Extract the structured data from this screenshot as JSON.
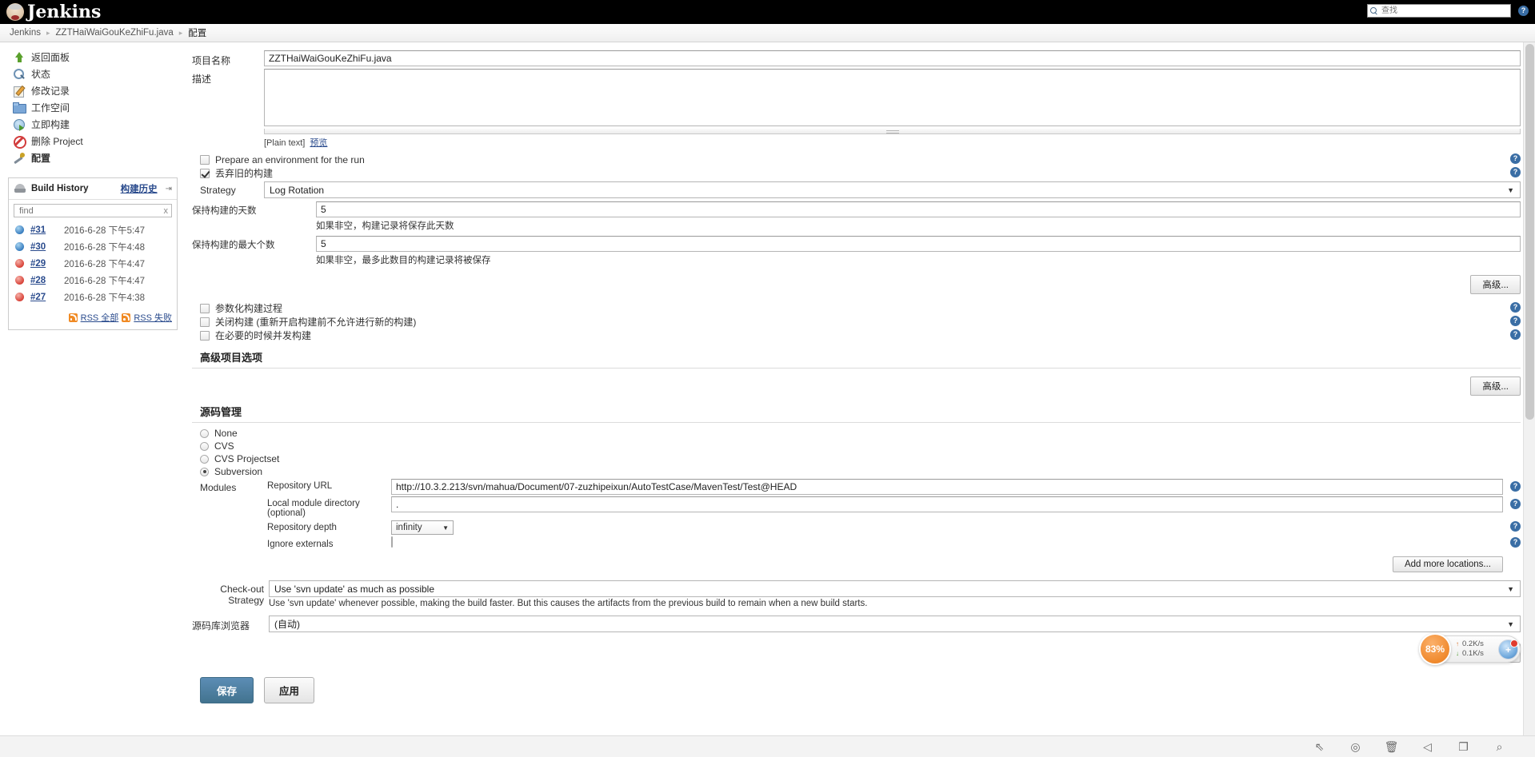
{
  "header": {
    "brand": "Jenkins",
    "search_placeholder": "查找",
    "help_label": "?"
  },
  "breadcrumb": {
    "root": "Jenkins",
    "project": "ZZTHaiWaiGouKeZhiFu.java",
    "current": "配置",
    "separator": "▸"
  },
  "sidebar": {
    "items": [
      {
        "label": "返回面板",
        "icon": "up-arrow-icon"
      },
      {
        "label": "状态",
        "icon": "search-icon"
      },
      {
        "label": "修改记录",
        "icon": "changes-icon"
      },
      {
        "label": "工作空间",
        "icon": "folder-icon"
      },
      {
        "label": "立即构建",
        "icon": "build-now-icon"
      },
      {
        "label": "删除 Project",
        "icon": "delete-icon"
      },
      {
        "label": "配置",
        "icon": "config-wrench-icon"
      }
    ],
    "build_history": {
      "title": "Build History",
      "link": "构建历史",
      "arrow": "⇥",
      "find_placeholder": "find",
      "clear": "x",
      "rows": [
        {
          "number": "#31",
          "date": "2016-6-28 下午5:47",
          "status": "blue"
        },
        {
          "number": "#30",
          "date": "2016-6-28 下午4:48",
          "status": "blue"
        },
        {
          "number": "#29",
          "date": "2016-6-28 下午4:47",
          "status": "red"
        },
        {
          "number": "#28",
          "date": "2016-6-28 下午4:47",
          "status": "red"
        },
        {
          "number": "#27",
          "date": "2016-6-28 下午4:38",
          "status": "red"
        }
      ],
      "rss_all": "RSS 全部",
      "rss_failed": "RSS 失败"
    }
  },
  "form": {
    "project_name_label": "项目名称",
    "project_name_value": "ZZTHaiWaiGouKeZhiFu.java",
    "description_label": "描述",
    "description_value": "",
    "plain_text": "[Plain text]",
    "preview_link": "预览",
    "prepare_env_label": "Prepare an environment for the run",
    "discard_builds_label": "丢弃旧的构建",
    "strategy_label": "Strategy",
    "strategy_value": "Log Rotation",
    "days_label": "保持构建的天数",
    "days_value": "5",
    "days_hint": "如果非空，构建记录将保存此天数",
    "max_label": "保持构建的最大个数",
    "max_value": "5",
    "max_hint": "如果非空，最多此数目的构建记录将被保存",
    "advanced_button": "高级...",
    "param_build_label": "参数化构建过程",
    "disable_build_label": "关闭构建 (重新开启构建前不允许进行新的构建)",
    "concurrent_build_label": "在必要的时候并发构建",
    "advanced_project_options": "高级项目选项"
  },
  "scm": {
    "title": "源码管理",
    "options": [
      {
        "label": "None",
        "selected": false
      },
      {
        "label": "CVS",
        "selected": false
      },
      {
        "label": "CVS Projectset",
        "selected": false
      },
      {
        "label": "Subversion",
        "selected": true
      }
    ],
    "modules_label": "Modules",
    "repo_url_label": "Repository URL",
    "repo_url_value": "http://10.3.2.213/svn/mahua/Document/07-zuzhipeixun/AutoTestCase/MavenTest/Test@HEAD",
    "local_dir_label": "Local module directory (optional)",
    "local_dir_value": ".",
    "depth_label": "Repository depth",
    "depth_value": "infinity",
    "ignore_externals_label": "Ignore externals",
    "add_locations_button": "Add more locations...",
    "checkout_strategy_label": "Check-out Strategy",
    "checkout_strategy_value": "Use 'svn update' as much as possible",
    "checkout_strategy_hint": "Use 'svn update' whenever possible, making the build faster. But this causes the artifacts from the previous build to remain when a new build starts.",
    "browser_label": "源码库浏览器",
    "browser_value": "(自动)",
    "advanced_button": "高级..."
  },
  "actions": {
    "save": "保存",
    "apply": "应用"
  },
  "net_widget": {
    "percent": "83%",
    "upload": "0.2K/s",
    "download": "0.1K/s",
    "up_arrow": "↑",
    "down_arrow": "↓",
    "ball_glyph": "+"
  },
  "taskbar": {
    "icons": [
      {
        "name": "pin-off-icon",
        "glyph": "⇖"
      },
      {
        "name": "compass-icon",
        "glyph": "◎"
      },
      {
        "name": "trash-icon",
        "glyph": "🗑"
      },
      {
        "name": "speaker-icon",
        "glyph": "◁"
      },
      {
        "name": "window-icon",
        "glyph": "❐"
      },
      {
        "name": "search-icon",
        "glyph": "⌕"
      }
    ]
  },
  "colors": {
    "accent": "#2a4b8d",
    "header_bg": "#000000",
    "primary_button": "#4a7d9e",
    "orange": "#f08a2e"
  }
}
